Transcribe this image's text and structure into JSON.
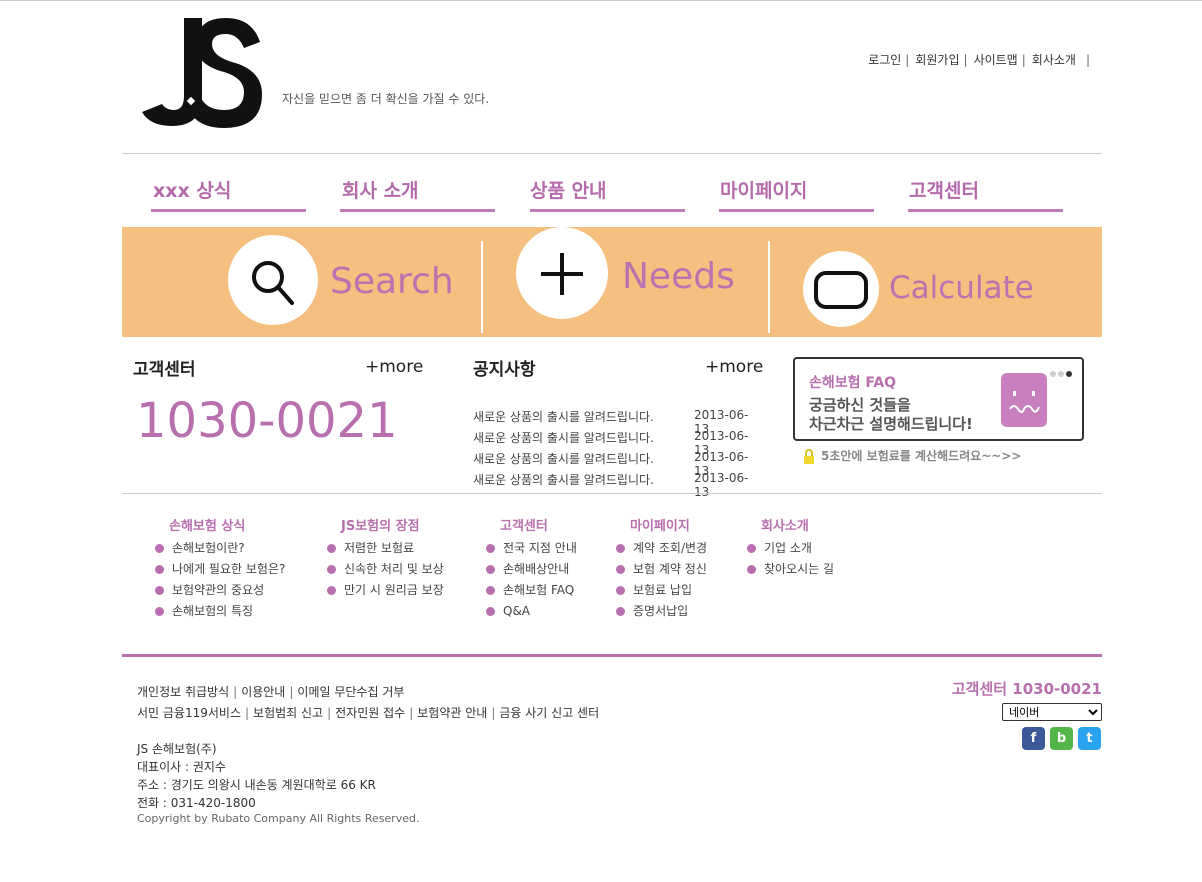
{
  "header": {
    "logo_text": "JS",
    "slogan": "자신을 믿으면 좀 더 확신을 가질 수 있다.",
    "util_links": [
      "로그인",
      "회원가입",
      "사이트맵",
      "회사소개"
    ],
    "util_sep": "|"
  },
  "gnb": [
    "xxx 상식",
    "회사 소개",
    "상품 안내",
    "마이페이지",
    "고객센터"
  ],
  "banner": {
    "items": [
      {
        "label": "Search",
        "icon": "search-icon"
      },
      {
        "label": "Needs",
        "icon": "plus-icon"
      },
      {
        "label": "Calculate",
        "icon": "calculator-icon"
      }
    ],
    "background": "#f5bf80",
    "accent": "#b974b0"
  },
  "customer_center": {
    "title": "고객센터",
    "more": "+more",
    "phone": "1030-0021"
  },
  "notice": {
    "title": "공지사항",
    "more": "+more",
    "rows": [
      {
        "title": "새로운 상품의 출시를 알려드립니다.",
        "date": "2013-06-13"
      },
      {
        "title": "새로운 상품의 출시를 알려드립니다.",
        "date": "2013-06-13"
      },
      {
        "title": "새로운 상품의 출시를 알려드립니다.",
        "date": "2013-06-13"
      },
      {
        "title": "새로운 상품의 출시를 알려드립니다.",
        "date": "2013-06-13"
      }
    ]
  },
  "faq": {
    "title": "손해보험 FAQ",
    "line1": "궁금하신 것들을",
    "line2": "차근차근 설명해드립니다!",
    "calc_link": "5초안에 보험료를 계산해드려요~~>>"
  },
  "sitemap": [
    {
      "head": "손해보험 상식",
      "items": [
        "손해보험이란?",
        "나에게 필요한 보험은?",
        "보험약관의 중요성",
        "손해보험의 특징"
      ]
    },
    {
      "head": "JS보험의 장점",
      "items": [
        "저렴한 보험료",
        "신속한 처리 및 보상",
        "만기 시 원리금 보장"
      ]
    },
    {
      "head": "고객센터",
      "items": [
        "전국 지점 안내",
        "손해배상안내",
        "손해보험 FAQ",
        "Q&A"
      ]
    },
    {
      "head": "마이페이지",
      "items": [
        "계약 조회/변경",
        "보험 계약 정신",
        "보험료 납입",
        "증명서납입"
      ]
    },
    {
      "head": "회사소개",
      "items": [
        "기업 소개",
        "찾아오시는 길"
      ]
    }
  ],
  "footer": {
    "links_row1": [
      "개인정보 취급방식",
      "이용안내",
      "이메일 무단수집 거부"
    ],
    "links_row2": [
      "서민 금융119서비스",
      "보험범죄 신고",
      "전자민원 접수",
      "보험약관 안내",
      "금융 사기 신고 센터"
    ],
    "company": "JS 손해보험(주)",
    "ceo": "대표이사 : 권지수",
    "address": "주소 : 경기도 의왕시 내손동 계원대학로 66 KR",
    "tel": "전화 : 031-420-1800",
    "copyright": "Copyright by Rubato Company All Rights Reserved.",
    "call_center": "고객센터 1030-0021",
    "select_value": "네이버",
    "sns": [
      {
        "name": "facebook-icon",
        "glyph": "f",
        "color": "#3b5998"
      },
      {
        "name": "blog-icon",
        "glyph": "b",
        "color": "#52b648"
      },
      {
        "name": "twitter-icon",
        "glyph": "t",
        "color": "#2aa3ef"
      }
    ]
  },
  "colors": {
    "brand": "#b86fae",
    "banner": "#f5bf80"
  }
}
